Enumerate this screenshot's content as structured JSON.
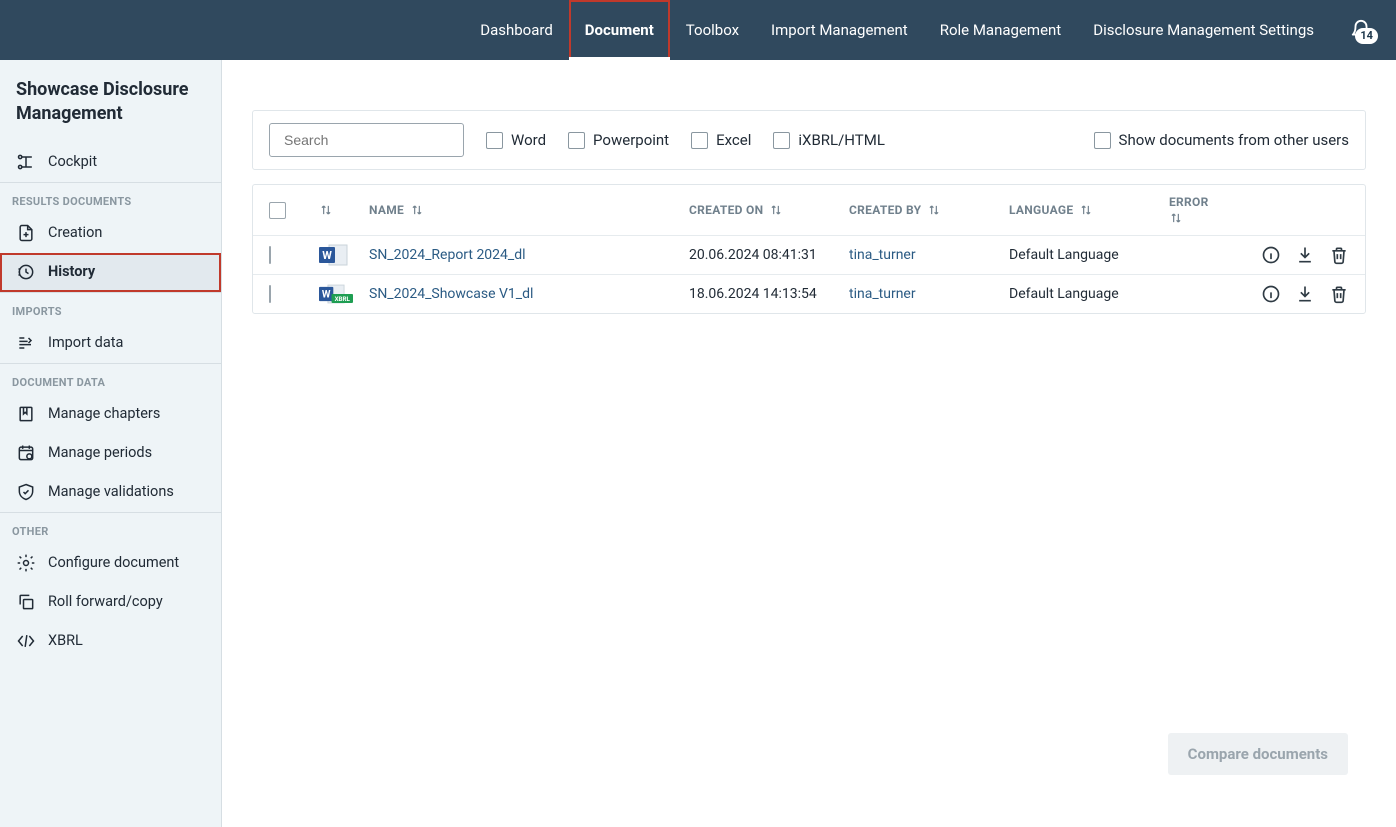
{
  "topnav": {
    "items": [
      "Dashboard",
      "Document",
      "Toolbox",
      "Import Management",
      "Role Management",
      "Disclosure Management Settings"
    ],
    "active_index": 1,
    "notification_count": "14"
  },
  "app_title": "Showcase Disclosure Management",
  "sidebar": {
    "cockpit": "Cockpit",
    "groups": [
      {
        "label": "RESULTS DOCUMENTS",
        "items": [
          {
            "id": "creation",
            "label": "Creation"
          },
          {
            "id": "history",
            "label": "History",
            "active": true
          }
        ]
      },
      {
        "label": "IMPORTS",
        "items": [
          {
            "id": "import-data",
            "label": "Import data"
          }
        ]
      },
      {
        "label": "DOCUMENT DATA",
        "items": [
          {
            "id": "manage-chapters",
            "label": "Manage chapters"
          },
          {
            "id": "manage-periods",
            "label": "Manage periods"
          },
          {
            "id": "manage-validations",
            "label": "Manage validations"
          }
        ]
      },
      {
        "label": "OTHER",
        "items": [
          {
            "id": "configure-document",
            "label": "Configure document"
          },
          {
            "id": "roll-forward",
            "label": "Roll forward/copy"
          },
          {
            "id": "xbrl",
            "label": "XBRL"
          }
        ]
      }
    ]
  },
  "filters": {
    "search_placeholder": "Search",
    "word": "Word",
    "powerpoint": "Powerpoint",
    "excel": "Excel",
    "ixbrl": "iXBRL/HTML",
    "show_others": "Show documents from other users"
  },
  "table": {
    "headers": {
      "name": "NAME",
      "created_on": "CREATED ON",
      "created_by": "CREATED BY",
      "language": "LANGUAGE",
      "error": "ERROR"
    },
    "rows": [
      {
        "icon": "word",
        "name": "SN_2024_Report 2024_dl",
        "created_on": "20.06.2024 08:41:31",
        "created_by": "tina_turner",
        "language": "Default Language"
      },
      {
        "icon": "word-xbrl",
        "name": "SN_2024_Showcase V1_dl",
        "created_on": "18.06.2024 14:13:54",
        "created_by": "tina_turner",
        "language": "Default Language"
      }
    ]
  },
  "compare_button": "Compare documents"
}
